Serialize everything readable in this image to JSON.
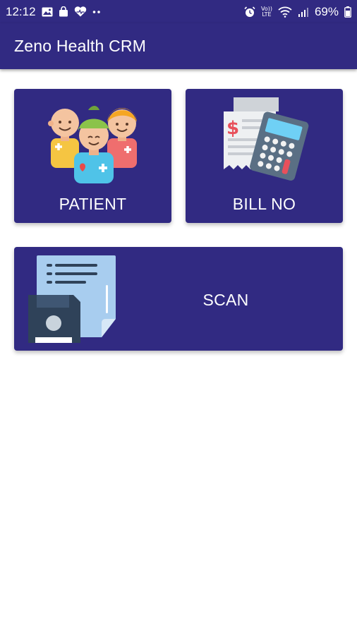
{
  "status_bar": {
    "time": "12:12",
    "battery": "69%",
    "volte_top": "Vo))",
    "volte_bottom": "LTE",
    "icons": [
      "gallery-icon",
      "bag-icon",
      "heart-icon",
      "more-dots-icon",
      "alarm-icon",
      "volte-icon",
      "wifi-icon",
      "signal-icon",
      "battery-icon"
    ]
  },
  "app_bar": {
    "title": "Zeno Health CRM"
  },
  "cards": {
    "patient": {
      "label": "PATIENT",
      "icon": "patients-group-icon"
    },
    "bill": {
      "label": "BILL NO",
      "icon": "bill-calculator-icon"
    },
    "scan": {
      "label": "SCAN",
      "icon": "document-save-icon"
    }
  },
  "colors": {
    "primary": "#312a82",
    "background": "#ffffff",
    "text_on_primary": "#ffffff"
  }
}
